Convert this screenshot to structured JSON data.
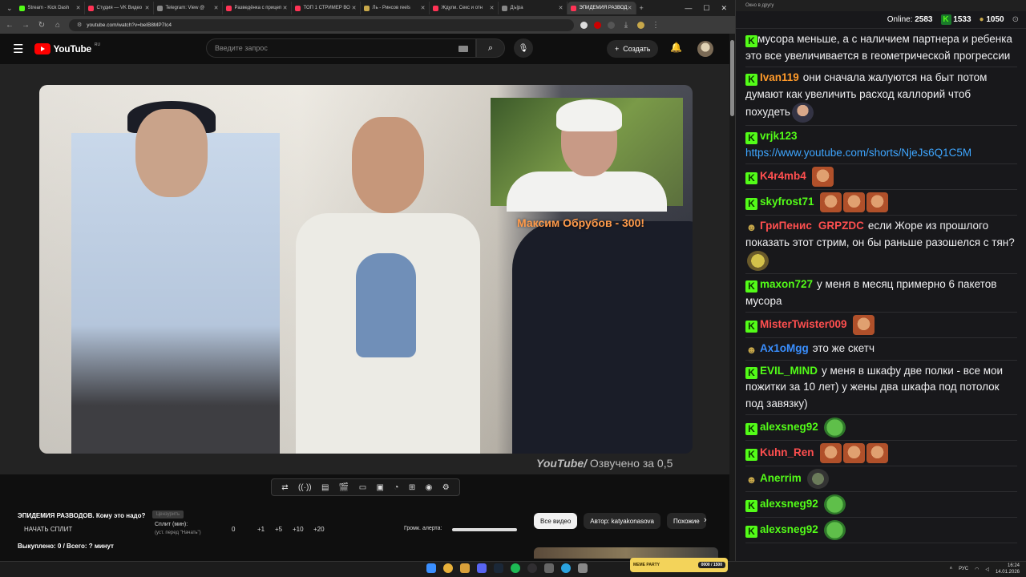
{
  "browser": {
    "tabs": [
      {
        "label": "Stream - Kick Dash",
        "color": "#53fc18"
      },
      {
        "label": "Студия — VK Видео",
        "color": "#ff3355"
      },
      {
        "label": "Telegram: View @",
        "color": "#888888"
      },
      {
        "label": "Разведёнка с прицеп",
        "color": "#ff3355"
      },
      {
        "label": "ТОП 1 СТРИМЕР ВО",
        "color": "#ff3355"
      },
      {
        "label": "Ль - Ринсов reels",
        "color": "#c8a84a"
      },
      {
        "label": "Ждули. Секс и отн",
        "color": "#ff3355"
      },
      {
        "label": "Дъ|ра",
        "color": "#888888"
      },
      {
        "label": "ЭПИДЕМИЯ РАЗВОД",
        "color": "#ff3355"
      }
    ],
    "url": "youtube.com/watch?v=beIB8MP7Ic4"
  },
  "youtube": {
    "logo": "YouTube",
    "region": "RU",
    "search_placeholder": "Введите запрос",
    "create_label": "Создать",
    "video": {
      "donation_overlay": "Максим Обрубов - 300!",
      "watermark_brand": "YouTube/",
      "watermark_text": " Озвучено за 0,5"
    },
    "title": "ЭПИДЕМИЯ РАЗВОДОВ. Кому это надо?",
    "censor_label": "Цензурить",
    "split": {
      "start": "НАЧАТЬ СПЛИТ",
      "label": "Сплит (мин):",
      "sub": "(уст. перед \"Начать\")",
      "values": [
        "0",
        "+1",
        "+5",
        "+10",
        "+20"
      ]
    },
    "alert": {
      "label": "Громк. алерта:",
      "level": 1
    },
    "bought": "Выкуплено: 0 / Всего: ? минут",
    "chips": [
      "Все видео",
      "Автор: katyakonasova",
      "Похожие"
    ]
  },
  "chat": {
    "window_title": "Окно в другу",
    "online_label": "Online:",
    "online": "2583",
    "followers": "1533",
    "subs": "1050",
    "messages": [
      {
        "user": "",
        "color": "#53fc18",
        "text": "мусора меньше, а с наличием партнера и ребенка это все увеличивается в геометрической прогрессии",
        "emotes": []
      },
      {
        "user": "Ivan119",
        "color": "#ff9a2a",
        "text": "они сначала жалуются на быт потом думают как увеличить расход каллорий чтоб похудеть",
        "emotes": [
          "em-man"
        ]
      },
      {
        "user": "vrjk123",
        "color": "#53fc18",
        "text": "",
        "link": "https://www.youtube.com/shorts/NjeJs6Q1C5M",
        "emotes": []
      },
      {
        "user": "K4r4mb4",
        "color": "#ff4f4f",
        "text": "",
        "emotes": [
          "em-face"
        ]
      },
      {
        "user": "skyfrost71",
        "color": "#53fc18",
        "text": "",
        "emotes": [
          "em-face",
          "em-face",
          "em-face"
        ]
      },
      {
        "user": "ГриПенис",
        "user2": "GRPZDC",
        "color": "#ff4f4f",
        "sub": true,
        "text": "если Жоре из прошлого показать этот стрим, он бы раньше разошелся с тян?",
        "emotes": [
          "em-pepe"
        ]
      },
      {
        "user": "maxon727",
        "color": "#53fc18",
        "text": "у меня в месяц примерно 6 пакетов мусора",
        "emotes": []
      },
      {
        "user": "MisterTwister009",
        "color": "#ff4f4f",
        "text": "",
        "emotes": [
          "em-face"
        ]
      },
      {
        "user": "Ax1oMgg",
        "color": "#3a8fff",
        "sub": true,
        "text": "это же скетч",
        "emotes": []
      },
      {
        "user": "EVIL_MIND",
        "color": "#53fc18",
        "text": "у меня в шкафу две полки - все мои пожитки за 10 лет) у жены два шкафа под потолок под завязку)",
        "emotes": []
      },
      {
        "user": "alexsneg92",
        "color": "#53fc18",
        "text": "",
        "emotes": [
          "em-frog"
        ]
      },
      {
        "user": "Kuhn_Ren",
        "color": "#ff4f4f",
        "text": "",
        "emotes": [
          "em-face",
          "em-face",
          "em-face"
        ]
      },
      {
        "user": "Anerrim",
        "color": "#53fc18",
        "sub": true,
        "text": "",
        "emotes": [
          "em-dark"
        ]
      },
      {
        "user": "alexsneg92",
        "color": "#53fc18",
        "text": "",
        "emotes": [
          "em-frog"
        ]
      },
      {
        "user": "alexsneg92",
        "color": "#53fc18",
        "text": "",
        "emotes": [
          "em-frog"
        ]
      }
    ]
  },
  "taskbar": {
    "lang": "РУС",
    "time": "16:24",
    "date": "14.01.2026",
    "meme_party_label": "MEME PARTY",
    "meme_party_count": "0000 / 1500"
  }
}
